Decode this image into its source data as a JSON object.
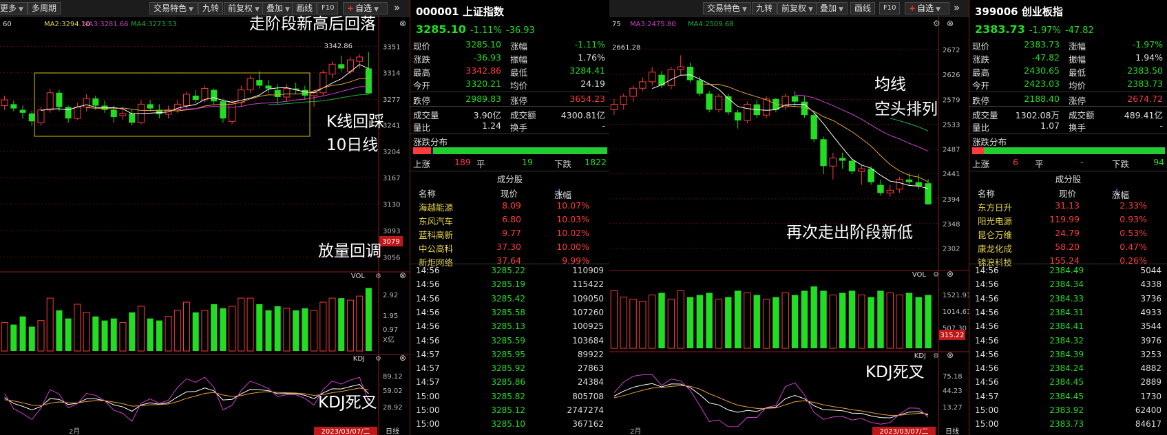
{
  "left": {
    "toolbar": {
      "more": "更多",
      "period": "多周期",
      "features": "交易特色",
      "nine": "九转",
      "adjust": "前复权",
      "overlay": "叠加",
      "draw": "画线",
      "f10": "F10",
      "watch": "自选"
    },
    "ma_legend": {
      "prefix": "60",
      "ma2": "MA2:3294.10",
      "ma3": "MA3:3281.66",
      "ma4": "MA4:3273.53"
    },
    "price_axis": [
      "3351",
      "3314",
      "3277",
      "3241",
      "3204",
      "3167",
      "3130",
      "3093",
      "3056"
    ],
    "current_price_tag": "3079",
    "high_label": "3342.86",
    "vol_label": "VOL",
    "vol_axis": [
      "2.92",
      "1.95",
      "0.97",
      "X亿"
    ],
    "kdj_label": "KDJ",
    "kdj_axis": [
      "89.12",
      "59.02",
      "28.92"
    ],
    "month_label": "2月",
    "date_tag": "2023/03/07/二",
    "daily_tab": "日线",
    "annotations": {
      "top": "走阶段新高后回落",
      "mid1": "K线回踩",
      "mid2": "10日线",
      "vol": "放量回调",
      "kdj": "KDJ死叉"
    },
    "colors": {
      "up": "#ff3b3b",
      "down": "#22dd22"
    }
  },
  "left_panel": {
    "code": "000001",
    "name": "上证指数",
    "price": "3285.10",
    "pct": "-1.11%",
    "chg": "-36.93",
    "quotes": [
      {
        "l1": "现价",
        "v1": "3285.10",
        "c1": "green",
        "l2": "涨幅",
        "v2": "-1.11%",
        "c2": "green"
      },
      {
        "l1": "涨跌",
        "v1": "-36.93",
        "c1": "green",
        "l2": "振幅",
        "v2": "1.76%",
        "c2": "white"
      },
      {
        "l1": "最高",
        "v1": "3342.86",
        "c1": "red",
        "l2": "最低",
        "v2": "3284.41",
        "c2": "green"
      },
      {
        "l1": "今开",
        "v1": "3320.21",
        "c1": "green",
        "l2": "均价",
        "v2": "24.19",
        "c2": "white"
      }
    ],
    "limit": {
      "l1": "跌停",
      "v1": "2989.83",
      "l2": "涨停",
      "v2": "3654.23"
    },
    "vol": [
      {
        "l1": "成交量",
        "v1": "3.90亿",
        "l2": "成交额",
        "v2": "4300.81亿"
      },
      {
        "l1": "量比",
        "v1": "1.24",
        "l2": "换手",
        "v2": "-"
      }
    ],
    "dist_title": "涨跌分布",
    "dist": {
      "up_label": "上涨",
      "up": "189",
      "flat_label": "平",
      "flat": "19",
      "down_label": "下跌",
      "down": "1822"
    },
    "const_title": "成分股",
    "const_headers": [
      "名称",
      "现价",
      "涨幅"
    ],
    "stocks": [
      {
        "name": "海越能源",
        "price": "8.09",
        "pct": "10.07%"
      },
      {
        "name": "东风汽车",
        "price": "6.80",
        "pct": "10.03%"
      },
      {
        "name": "蓝科高新",
        "price": "9.77",
        "pct": "10.02%"
      },
      {
        "name": "中公高科",
        "price": "37.30",
        "pct": "10.00%"
      },
      {
        "name": "新炬网络",
        "price": "37.64",
        "pct": "9.99%"
      }
    ],
    "ticks": [
      {
        "t": "14:56",
        "p": "3285.22",
        "v": "110909"
      },
      {
        "t": "14:56",
        "p": "3285.19",
        "v": "115422"
      },
      {
        "t": "14:56",
        "p": "3285.42",
        "v": "109050"
      },
      {
        "t": "14:56",
        "p": "3285.58",
        "v": "107260"
      },
      {
        "t": "14:56",
        "p": "3285.13",
        "v": "100925"
      },
      {
        "t": "14:56",
        "p": "3285.59",
        "v": "103684"
      },
      {
        "t": "14:57",
        "p": "3285.95",
        "v": "89922"
      },
      {
        "t": "14:57",
        "p": "3285.92",
        "v": "27863"
      },
      {
        "t": "14:57",
        "p": "3285.86",
        "v": "24384"
      },
      {
        "t": "15:00",
        "p": "3285.82",
        "v": "805708"
      },
      {
        "t": "15:00",
        "p": "3285.12",
        "v": "2747274"
      },
      {
        "t": "15:00",
        "p": "3285.10",
        "v": "367162"
      }
    ]
  },
  "right": {
    "toolbar": {
      "features": "交易特色",
      "nine": "九转",
      "adjust": "前复权",
      "overlay": "叠加",
      "draw": "画线",
      "f10": "F10",
      "watch": "自选"
    },
    "ma_legend": {
      "prefix": "75",
      "ma3": "MA3:2475.80",
      "ma4": "MA4:2509.68"
    },
    "price_axis": [
      "2672",
      "2626",
      "2579",
      "2533",
      "2487",
      "2441",
      "2394",
      "2348",
      "2302"
    ],
    "high_label": "2661.28",
    "vol_label": "VOL",
    "vol_axis": [
      "1521.91",
      "1014.61",
      "507.30"
    ],
    "vol_tag": "315.22",
    "kdj_label": "KDJ",
    "kdj_axis": [
      "75.18",
      "44.23",
      "13.27"
    ],
    "month_label": "2月",
    "date_tag": "2023/03/07/二",
    "daily_tab": "日线",
    "annotations": {
      "ma1": "均线",
      "ma2": "空头排列",
      "low": "再次走出阶段新低",
      "kdj": "KDJ死叉"
    }
  },
  "right_panel": {
    "code": "399006",
    "name": "创业板指",
    "price": "2383.73",
    "pct": "-1.97%",
    "chg": "-47.82",
    "quotes": [
      {
        "l1": "现价",
        "v1": "2383.73",
        "c1": "green",
        "l2": "涨幅",
        "v2": "-1.97%",
        "c2": "green"
      },
      {
        "l1": "涨跌",
        "v1": "-47.82",
        "c1": "green",
        "l2": "振幅",
        "v2": "1.94%",
        "c2": "white"
      },
      {
        "l1": "最高",
        "v1": "2430.65",
        "c1": "green",
        "l2": "最低",
        "v2": "2383.50",
        "c2": "green"
      },
      {
        "l1": "今开",
        "v1": "2423.03",
        "c1": "green",
        "l2": "均价",
        "v2": "2383.73",
        "c2": "green"
      }
    ],
    "limit": {
      "l1": "跌停",
      "v1": "2188.40",
      "l2": "涨停",
      "v2": "2674.72"
    },
    "vol": [
      {
        "l1": "成交量",
        "v1": "1302.08万",
        "l2": "成交额",
        "v2": "489.41亿"
      },
      {
        "l1": "量比",
        "v1": "1.07",
        "l2": "换手",
        "v2": "-"
      }
    ],
    "dist_title": "涨跌分布",
    "dist": {
      "up_label": "上涨",
      "up": "6",
      "flat_label": "平",
      "flat": "-",
      "down_label": "下跌",
      "down": "94"
    },
    "const_title": "成分股",
    "const_headers": [
      "名称",
      "现价",
      "涨幅"
    ],
    "stocks": [
      {
        "name": "东方日升",
        "price": "31.13",
        "pct": "2.33%"
      },
      {
        "name": "阳光电源",
        "price": "119.99",
        "pct": "0.93%"
      },
      {
        "name": "昆仑万维",
        "price": "24.79",
        "pct": "0.53%"
      },
      {
        "name": "康龙化成",
        "price": "58.20",
        "pct": "0.47%"
      },
      {
        "name": "锦浪科技",
        "price": "155.24",
        "pct": "0.26%"
      }
    ],
    "ticks": [
      {
        "t": "14:56",
        "p": "2384.49",
        "v": "5044"
      },
      {
        "t": "14:56",
        "p": "2384.34",
        "v": "4338"
      },
      {
        "t": "14:56",
        "p": "2384.33",
        "v": "3736"
      },
      {
        "t": "14:56",
        "p": "2384.31",
        "v": "4933"
      },
      {
        "t": "14:56",
        "p": "2384.41",
        "v": "3544"
      },
      {
        "t": "14:56",
        "p": "2384.32",
        "v": "3976"
      },
      {
        "t": "14:56",
        "p": "2384.39",
        "v": "3253"
      },
      {
        "t": "14:56",
        "p": "2384.24",
        "v": "4882"
      },
      {
        "t": "14:56",
        "p": "2384.45",
        "v": "2889"
      },
      {
        "t": "14:57",
        "p": "2384.45",
        "v": "1730"
      },
      {
        "t": "15:00",
        "p": "2383.92",
        "v": "62400"
      },
      {
        "t": "15:00",
        "p": "2383.73",
        "v": "84617"
      }
    ]
  },
  "chart_data": [
    {
      "type": "candlestick",
      "title": "上证指数",
      "candles_ohlc": [
        [
          3268,
          3282,
          3262,
          3276
        ],
        [
          3270,
          3275,
          3260,
          3264
        ],
        [
          3262,
          3268,
          3250,
          3258
        ],
        [
          3257,
          3261,
          3240,
          3246
        ],
        [
          3244,
          3266,
          3240,
          3262
        ],
        [
          3262,
          3292,
          3258,
          3286
        ],
        [
          3286,
          3290,
          3260,
          3266
        ],
        [
          3266,
          3268,
          3244,
          3250
        ],
        [
          3250,
          3272,
          3248,
          3266
        ],
        [
          3266,
          3284,
          3260,
          3278
        ],
        [
          3278,
          3282,
          3262,
          3268
        ],
        [
          3268,
          3275,
          3258,
          3262
        ],
        [
          3262,
          3268,
          3244,
          3252
        ],
        [
          3254,
          3262,
          3248,
          3257
        ],
        [
          3257,
          3262,
          3240,
          3244
        ],
        [
          3244,
          3276,
          3242,
          3270
        ],
        [
          3270,
          3276,
          3260,
          3264
        ],
        [
          3262,
          3270,
          3250,
          3256
        ],
        [
          3256,
          3268,
          3250,
          3262
        ],
        [
          3262,
          3276,
          3258,
          3270
        ],
        [
          3268,
          3288,
          3264,
          3284
        ],
        [
          3282,
          3290,
          3272,
          3276
        ],
        [
          3276,
          3296,
          3272,
          3292
        ],
        [
          3290,
          3292,
          3270,
          3274
        ],
        [
          3274,
          3278,
          3244,
          3250
        ],
        [
          3246,
          3276,
          3242,
          3272
        ],
        [
          3272,
          3296,
          3266,
          3290
        ],
        [
          3290,
          3310,
          3286,
          3306
        ],
        [
          3304,
          3316,
          3292,
          3296
        ],
        [
          3296,
          3304,
          3286,
          3292
        ],
        [
          3290,
          3298,
          3270,
          3280
        ],
        [
          3280,
          3298,
          3274,
          3292
        ],
        [
          3292,
          3300,
          3284,
          3290
        ],
        [
          3290,
          3296,
          3276,
          3282
        ],
        [
          3282,
          3290,
          3266,
          3286
        ],
        [
          3286,
          3318,
          3282,
          3314
        ],
        [
          3312,
          3330,
          3306,
          3326
        ],
        [
          3326,
          3338,
          3316,
          3320
        ],
        [
          3316,
          3336,
          3312,
          3332
        ],
        [
          3330,
          3340,
          3320,
          3336
        ],
        [
          3320,
          3342.86,
          3284.41,
          3285.1
        ]
      ],
      "volume": [
        1.4,
        1.3,
        1.7,
        1.2,
        1.5,
        2.6,
        2.0,
        1.6,
        2.3,
        1.9,
        1.7,
        1.5,
        1.6,
        1.4,
        1.9,
        2.2,
        1.6,
        1.5,
        1.7,
        2.0,
        2.4,
        1.9,
        2.0,
        2.3,
        2.1,
        2.2,
        2.6,
        2.6,
        2.3,
        2.0,
        2.2,
        2.1,
        2.0,
        2.1,
        2.0,
        2.4,
        2.6,
        2.6,
        2.5,
        2.7,
        3.1
      ],
      "ylim": [
        3040,
        3360
      ],
      "ylabel": "",
      "x_label": "2月"
    },
    {
      "type": "candlestick",
      "title": "创业板指",
      "candles_ohlc": [
        [
          2560,
          2580,
          2550,
          2570
        ],
        [
          2570,
          2590,
          2560,
          2585
        ],
        [
          2585,
          2605,
          2575,
          2600
        ],
        [
          2600,
          2620,
          2595,
          2612
        ],
        [
          2612,
          2640,
          2605,
          2630
        ],
        [
          2625,
          2632,
          2600,
          2605
        ],
        [
          2605,
          2640,
          2598,
          2635
        ],
        [
          2635,
          2661.28,
          2625,
          2640
        ],
        [
          2640,
          2648,
          2610,
          2615
        ],
        [
          2615,
          2622,
          2585,
          2590
        ],
        [
          2590,
          2595,
          2555,
          2560
        ],
        [
          2560,
          2590,
          2555,
          2585
        ],
        [
          2585,
          2590,
          2550,
          2555
        ],
        [
          2555,
          2560,
          2525,
          2540
        ],
        [
          2540,
          2575,
          2535,
          2570
        ],
        [
          2570,
          2578,
          2545,
          2550
        ],
        [
          2550,
          2585,
          2545,
          2580
        ],
        [
          2580,
          2582,
          2555,
          2560
        ],
        [
          2565,
          2590,
          2560,
          2585
        ],
        [
          2585,
          2595,
          2565,
          2575
        ],
        [
          2575,
          2585,
          2545,
          2550
        ],
        [
          2550,
          2555,
          2500,
          2505
        ],
        [
          2505,
          2510,
          2440,
          2455
        ],
        [
          2455,
          2480,
          2430,
          2470
        ],
        [
          2470,
          2480,
          2450,
          2465
        ],
        [
          2465,
          2470,
          2440,
          2445
        ],
        [
          2445,
          2458,
          2420,
          2450
        ],
        [
          2450,
          2455,
          2420,
          2425
        ],
        [
          2420,
          2430,
          2400,
          2405
        ],
        [
          2405,
          2420,
          2398,
          2410
        ],
        [
          2412,
          2435,
          2405,
          2430
        ],
        [
          2430,
          2442,
          2420,
          2425
        ],
        [
          2425,
          2440,
          2412,
          2418
        ],
        [
          2423.03,
          2430.65,
          2383.5,
          2383.73
        ]
      ],
      "volume": [
        1350,
        1200,
        1150,
        1100,
        1250,
        1300,
        1150,
        1350,
        1200,
        1250,
        1300,
        1150,
        1200,
        1350,
        1300,
        1250,
        1150,
        1200,
        1300,
        1250,
        1350,
        1450,
        1350,
        1250,
        1300,
        1350,
        1250,
        1200,
        1350,
        1300,
        1250,
        1300,
        1200,
        1250
      ],
      "ylim": [
        2290,
        2690
      ],
      "ylabel": "",
      "x_label": "2月"
    }
  ]
}
